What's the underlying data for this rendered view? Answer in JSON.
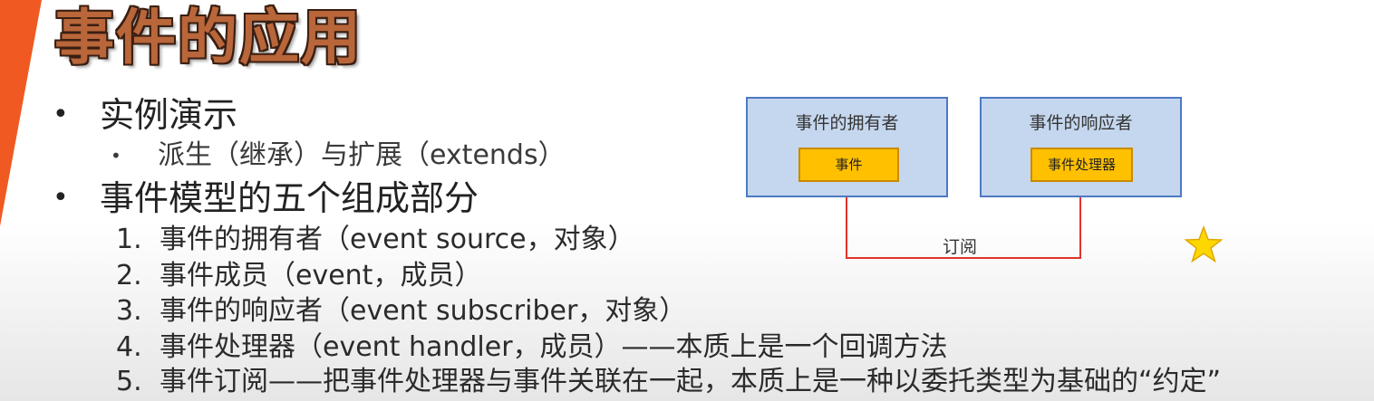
{
  "slide": {
    "title": "事件的应用",
    "bullets": [
      {
        "text": "实例演示",
        "sub": [
          {
            "text": "派生（继承）与扩展（extends）"
          }
        ]
      },
      {
        "text": "事件模型的五个组成部分"
      }
    ],
    "numbered": [
      {
        "num": "1.",
        "text": "事件的拥有者（event source，对象）"
      },
      {
        "num": "2.",
        "text": "事件成员（event，成员）"
      },
      {
        "num": "3.",
        "text": "事件的响应者（event subscriber，对象）"
      },
      {
        "num": "4.",
        "text": "事件处理器（event handler，成员）——本质上是一个回调方法"
      },
      {
        "num": "5.",
        "text": "事件订阅——把事件处理器与事件关联在一起，本质上是一种以委托类型为基础的“约定”"
      }
    ]
  },
  "diagram": {
    "owner_box": {
      "title": "事件的拥有者",
      "inner": "事件"
    },
    "responder_box": {
      "title": "事件的响应者",
      "inner": "事件处理器"
    },
    "arrow_label": "订阅",
    "colors": {
      "box_fill": "#c5d7ee",
      "box_border": "#4d79c2",
      "inner_fill": "#ffc000",
      "arrow": "#e0332b",
      "star": "#ffd700",
      "accent": "#f05a22",
      "title_fill": "#b9663a"
    },
    "icons": [
      "star-icon"
    ]
  }
}
